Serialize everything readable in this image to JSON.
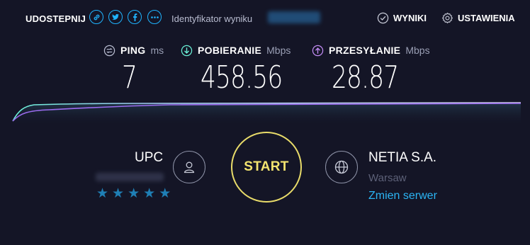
{
  "header": {
    "share_label": "UDOSTEPNIJ",
    "share_icons": [
      "link-icon",
      "twitter-icon",
      "facebook-icon",
      "more-icon"
    ],
    "result_id_label": "Identyfikator wyniku",
    "results_link": "WYNIKI",
    "settings_link": "USTAWIENIA"
  },
  "metrics": {
    "ping": {
      "label": "PING",
      "unit": "ms",
      "value": "7",
      "color": "#c4c7d6"
    },
    "download": {
      "label": "POBIERANIE",
      "unit": "Mbps",
      "value": "458.56",
      "color": "#6af2d8"
    },
    "upload": {
      "label": "PRZESYŁANIE",
      "unit": "Mbps",
      "value": "28.87",
      "color": "#c38cf5"
    }
  },
  "isp": {
    "name": "UPC",
    "rating_stars": 5
  },
  "start_label": "START",
  "server": {
    "name": "NETIA S.A.",
    "city": "Warsaw",
    "change_link": "Zmien serwer"
  },
  "colors": {
    "background": "#141526",
    "accent_blue": "#2bb5f5",
    "start_yellow": "#f3e46f",
    "download_line": "#6af2d8",
    "upload_line": "#9c6cf0"
  }
}
